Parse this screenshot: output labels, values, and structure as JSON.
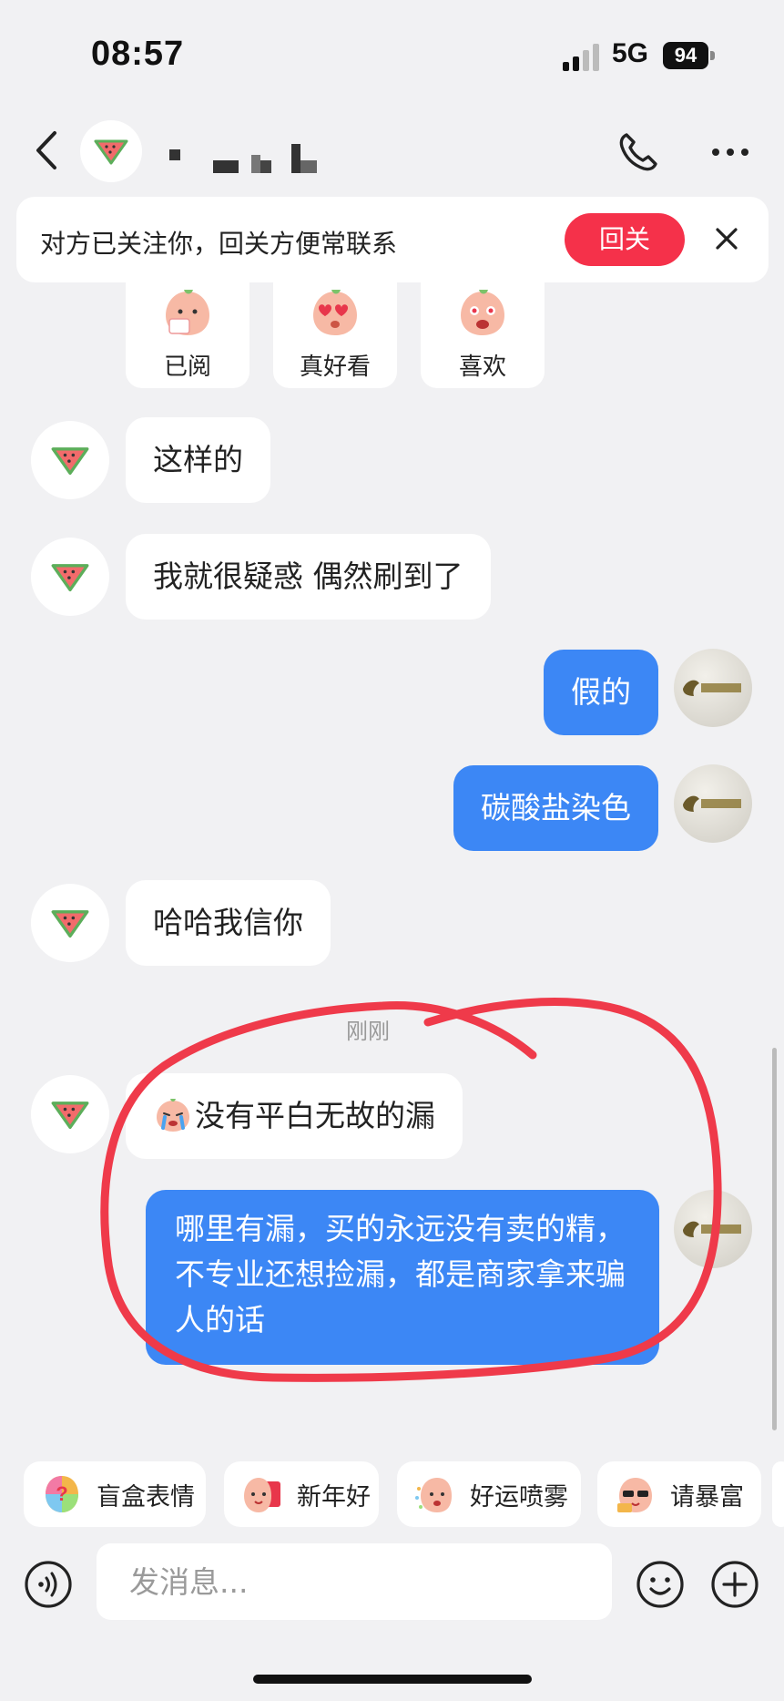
{
  "status_bar": {
    "time": "08:57",
    "network": "5G",
    "battery": "94"
  },
  "header": {
    "contact_name": "▪ ▬▪▌ ▙",
    "icons": [
      "back-arrow-icon",
      "phone-icon",
      "more-icon"
    ]
  },
  "banner": {
    "text": "对方已关注你，回关方便常联系",
    "button": "回关"
  },
  "reactions": [
    {
      "label": "已阅",
      "icon": "peach-reading-icon"
    },
    {
      "label": "真好看",
      "icon": "peach-heart-eyes-icon"
    },
    {
      "label": "喜欢",
      "icon": "peach-love-icon"
    }
  ],
  "messages": [
    {
      "side": "in",
      "text": "这样的"
    },
    {
      "side": "in",
      "text": "我就很疑惑 偶然刷到了"
    },
    {
      "side": "out",
      "text": "假的"
    },
    {
      "side": "out",
      "text": "碳酸盐染色"
    },
    {
      "side": "in",
      "text": "哈哈我信你"
    },
    {
      "side": "in",
      "text": "没有平白无故的漏"
    },
    {
      "side": "out",
      "text": "哪里有漏，买的永远没有卖的精，不专业还想捡漏，都是商家拿来骗人的话"
    }
  ],
  "timestamp": "刚刚",
  "quick_replies": [
    {
      "label": "盲盒表情",
      "icon": "mystery-box-icon"
    },
    {
      "label": "新年好",
      "icon": "new-year-peach-icon"
    },
    {
      "label": "好运喷雾",
      "icon": "luck-spray-icon"
    },
    {
      "label": "请暴富",
      "icon": "rich-peach-icon"
    }
  ],
  "composer": {
    "placeholder": "发消息..."
  },
  "colors": {
    "accent_blue": "#3c87f5",
    "follow_red": "#f5314a",
    "background": "#f1f1f3",
    "annotation_red": "#ef3a4a"
  }
}
